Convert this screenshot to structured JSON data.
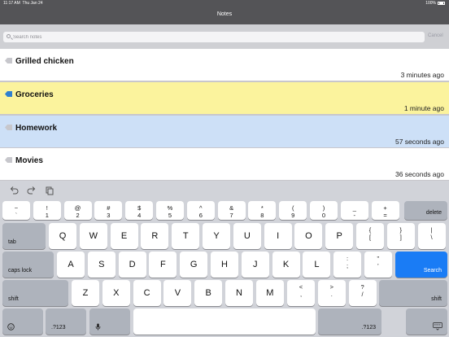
{
  "status_bar": {
    "time": "11:17 AM",
    "date": "Thu Jan 24",
    "battery": "100%"
  },
  "nav": {
    "title": "Notes"
  },
  "search": {
    "placeholder": "Search notes",
    "value": "",
    "cancel_label": "Cancel"
  },
  "notes": [
    {
      "name": "Grilled chicken",
      "time": "3 minutes ago",
      "color": "#ffffff",
      "tag_color": "#c7c7cc"
    },
    {
      "name": "Groceries",
      "time": "1 minute ago",
      "color": "#fbf39d",
      "tag_color": "#2f7fcf"
    },
    {
      "name": "Homework",
      "time": "57 seconds ago",
      "color": "#cde0f7",
      "tag_color": "#c7c7cc"
    },
    {
      "name": "Movies",
      "time": "36 seconds ago",
      "color": "#ffffff",
      "tag_color": "#c7c7cc"
    }
  ],
  "keyboard": {
    "toolbar": [
      "undo-icon",
      "redo-icon",
      "paste-icon"
    ],
    "number_row": [
      {
        "top": "~",
        "bottom": "`"
      },
      {
        "top": "!",
        "bottom": "1"
      },
      {
        "top": "@",
        "bottom": "2"
      },
      {
        "top": "#",
        "bottom": "3"
      },
      {
        "top": "$",
        "bottom": "4"
      },
      {
        "top": "%",
        "bottom": "5"
      },
      {
        "top": "^",
        "bottom": "6"
      },
      {
        "top": "&",
        "bottom": "7"
      },
      {
        "top": "*",
        "bottom": "8"
      },
      {
        "top": "(",
        "bottom": "9"
      },
      {
        "top": ")",
        "bottom": "0"
      },
      {
        "top": "_",
        "bottom": "-"
      },
      {
        "top": "+",
        "bottom": "="
      }
    ],
    "delete_label": "delete",
    "tab_label": "tab",
    "row_q": [
      "Q",
      "W",
      "E",
      "R",
      "T",
      "Y",
      "U",
      "I",
      "O",
      "P"
    ],
    "row_q_symbols": [
      {
        "top": "{",
        "bottom": "["
      },
      {
        "top": "}",
        "bottom": "]"
      },
      {
        "top": "|",
        "bottom": "\\"
      }
    ],
    "caps_label": "caps lock",
    "row_a": [
      "A",
      "S",
      "D",
      "F",
      "G",
      "H",
      "J",
      "K",
      "L"
    ],
    "row_a_symbols": [
      {
        "top": ":",
        "bottom": ";"
      },
      {
        "top": "”",
        "bottom": "’"
      }
    ],
    "search_label": "Search",
    "shift_label": "shift",
    "row_z": [
      "Z",
      "X",
      "C",
      "V",
      "B",
      "N",
      "M"
    ],
    "row_z_symbols": [
      {
        "top": "<",
        "bottom": ","
      },
      {
        "top": ">",
        "bottom": "."
      },
      {
        "top": "?",
        "bottom": "/"
      }
    ],
    "mode_label": ".?123",
    "emoji_icon": "emoji-icon",
    "mic_icon": "microphone-icon",
    "hide_keyboard_icon": "keyboard-dismiss-icon"
  }
}
